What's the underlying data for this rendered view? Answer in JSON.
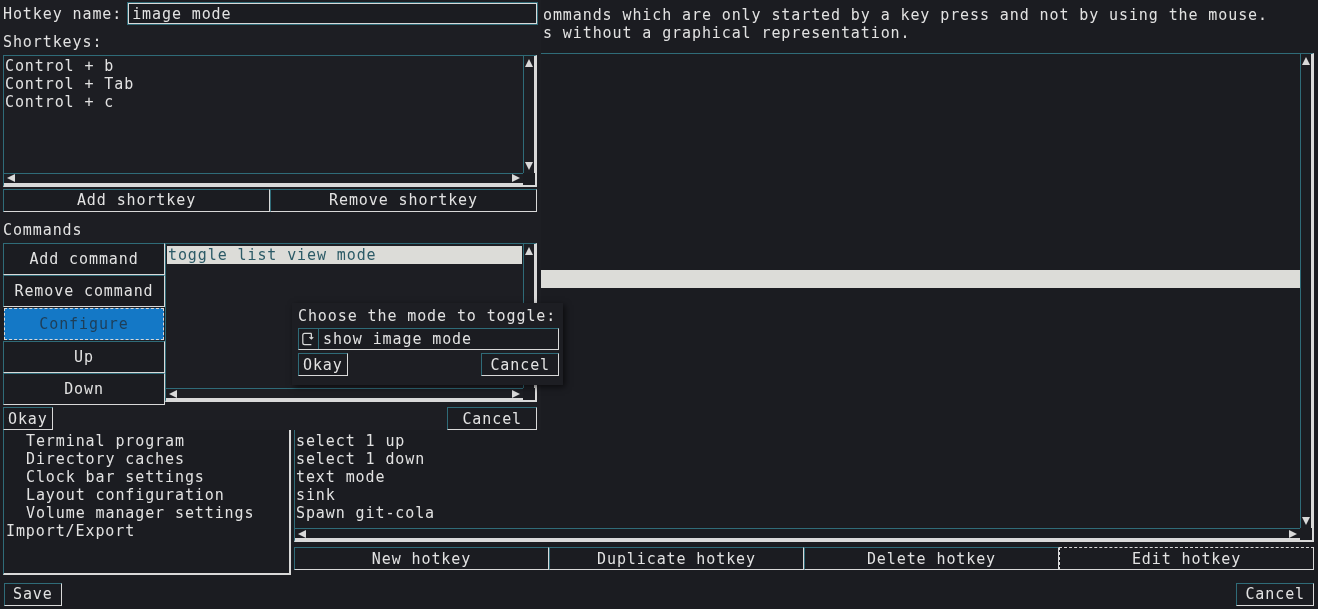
{
  "description": {
    "lines": [
      "ommands which are only started by a key press and not by using the mouse.",
      "s without a graphical representation."
    ]
  },
  "sidebar": {
    "items": [
      {
        "children": [
          {
            "label": "Terminal program"
          },
          {
            "label": "Directory caches"
          },
          {
            "label": "Clock bar settings"
          },
          {
            "label": "Layout configuration"
          },
          {
            "label": "Volume manager settings"
          }
        ]
      },
      {
        "label": "Import/Export"
      }
    ]
  },
  "hotkey_list": {
    "highlighted_row": {
      "selected": true
    },
    "rows": [
      "select 1 up",
      "select 1 down",
      "text mode",
      "sink",
      "Spawn git-cola"
    ]
  },
  "hotkey_buttons": [
    {
      "label": "New hotkey",
      "focused": false
    },
    {
      "label": "Duplicate hotkey",
      "focused": false
    },
    {
      "label": "Delete hotkey",
      "focused": false
    },
    {
      "label": "Edit hotkey",
      "focused": true
    }
  ],
  "footer": {
    "save": "Save",
    "cancel": "Cancel"
  },
  "hotkey_dialog": {
    "name_label": "Hotkey name:",
    "name_value": "image mode",
    "shortkeys_label": "Shortkeys:",
    "shortkeys": [
      "Control + b",
      "Control + Tab",
      "Control + c"
    ],
    "shortkey_buttons": [
      "Add shortkey",
      "Remove shortkey"
    ],
    "commands_label": "Commands",
    "command_buttons": [
      {
        "label": "Add command",
        "selected": false
      },
      {
        "label": "Remove command",
        "selected": false
      },
      {
        "label": "Configure",
        "selected": true
      },
      {
        "label": "Up",
        "selected": false
      },
      {
        "label": "Down",
        "selected": false
      }
    ],
    "commands": [
      {
        "label": "toggle list view mode",
        "selected": true
      }
    ],
    "okay": "Okay",
    "cancel": "Cancel"
  },
  "mode_dialog": {
    "prompt": "Choose the mode to toggle:",
    "choice": "show image mode",
    "okay": "Okay",
    "cancel": "Cancel"
  }
}
